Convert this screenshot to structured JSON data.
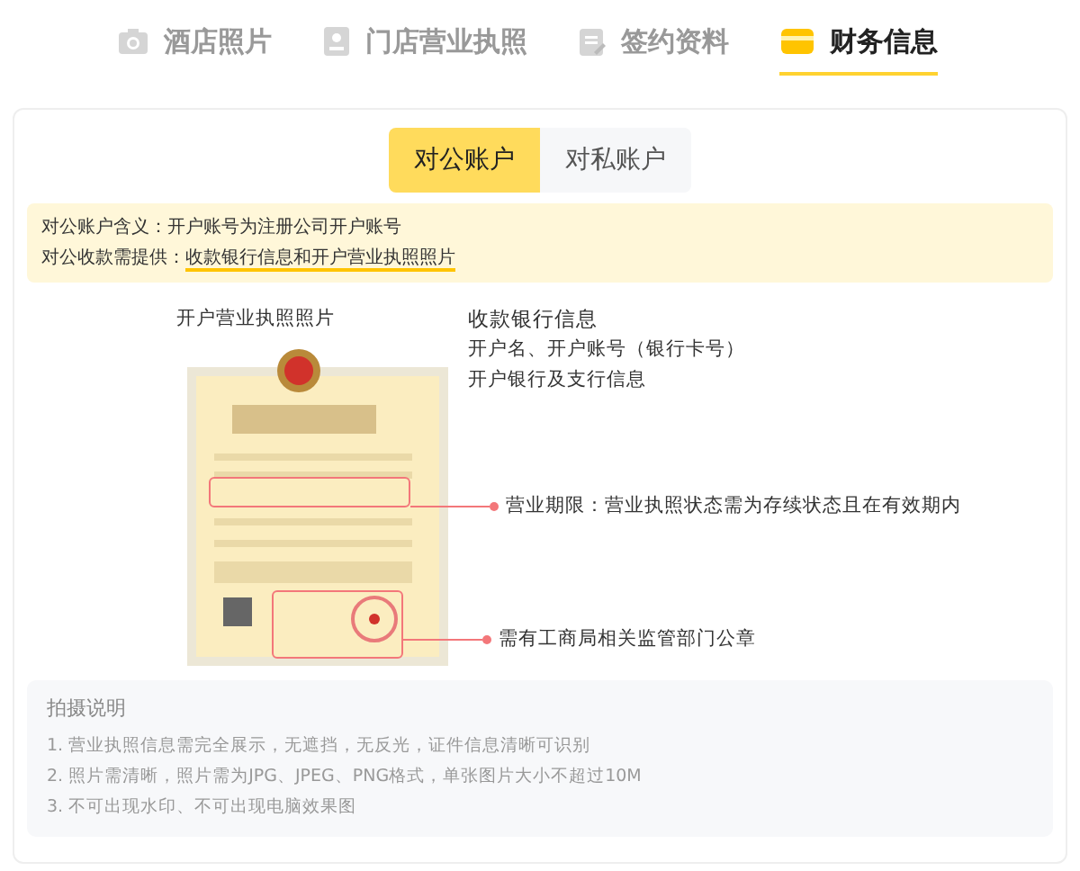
{
  "tabs": [
    {
      "label": "酒店照片",
      "kind": "camera",
      "selected": false
    },
    {
      "label": "门店营业执照",
      "kind": "badge",
      "selected": false
    },
    {
      "label": "签约资料",
      "kind": "document",
      "selected": false
    },
    {
      "label": "财务信息",
      "kind": "card",
      "selected": true
    }
  ],
  "account_types": [
    {
      "label": "对公账户",
      "selected": true
    },
    {
      "label": "对私账户",
      "selected": false
    }
  ],
  "notice": {
    "lines": [
      {
        "label": "对公账户含义：",
        "text": "开户账号为注册公司开户账号",
        "underlined": false
      },
      {
        "label": "对公收款需提供：",
        "text": "收款银行信息和开户营业执照照片",
        "underlined": true
      }
    ]
  },
  "license": {
    "title": "开户营业执照照片",
    "annotations": [
      "营业期限：营业执照状态需为存续状态且在有效期内",
      "需有工商局相关监管部门公章"
    ]
  },
  "bank_info": {
    "title": "收款银行信息",
    "lines": [
      "开户名、开户账号（银行卡号）",
      "开户银行及支行信息"
    ]
  },
  "instructions": {
    "title": "拍摄说明",
    "items": [
      "1. 营业执照信息需完全展示，无遮挡，无反光，证件信息清晰可识别",
      "2. 照片需清晰，照片需为JPG、JPEG、PNG格式，单张图片大小不超过10M",
      "3. 不可出现水印、不可出现电脑效果图"
    ]
  }
}
